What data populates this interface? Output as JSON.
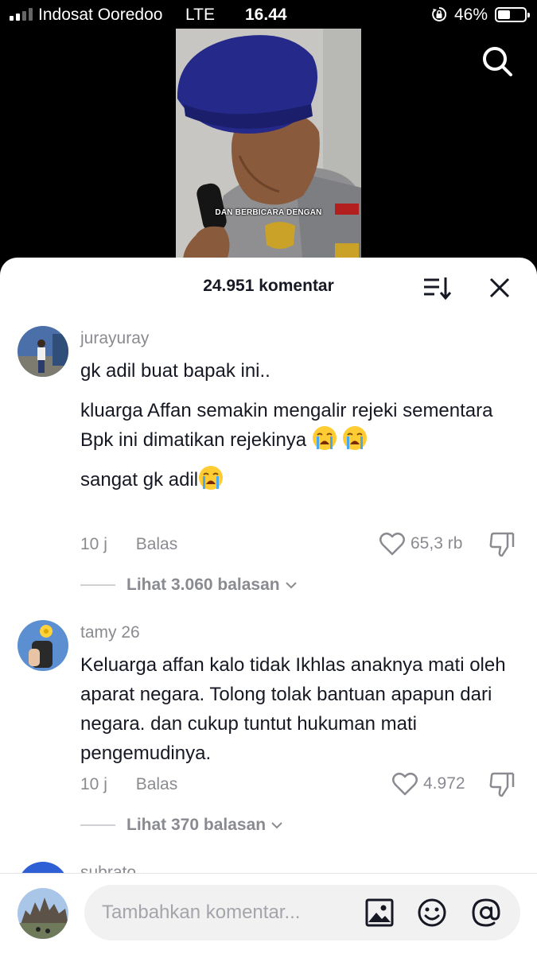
{
  "status_bar": {
    "carrier": "Indosat Ooredoo",
    "network": "LTE",
    "time": "16.44",
    "battery_percent": "46%",
    "battery_level": 0.46
  },
  "video": {
    "caption": "DAN BERBICARA DENGAN"
  },
  "comments_sheet": {
    "count_label": "24.951 komentar",
    "comments": [
      {
        "username": "jurayuray",
        "paragraphs": [
          "gk adil buat bapak ini..",
          "kluarga Affan semakin mengalir rejeki sementara Bpk ini dimatikan rejekinya",
          "sangat gk adil"
        ],
        "time": "10 j",
        "reply_label": "Balas",
        "likes": "65,3 rb",
        "view_replies": "Lihat 3.060 balasan"
      },
      {
        "username": "tamy 26",
        "paragraphs": [
          "Keluarga affan kalo tidak Ikhlas anaknya mati oleh aparat negara. Tolong tolak bantuan apapun dari negara. dan cukup tuntut hukuman mati pengemudinya."
        ],
        "time": "10 j",
        "reply_label": "Balas",
        "likes": "4.972",
        "view_replies": "Lihat 370 balasan"
      }
    ],
    "partial_username": "subrato"
  },
  "composer": {
    "placeholder": "Tambahkan komentar..."
  },
  "icons": {
    "search": "search-icon",
    "sort": "sort-icon",
    "close": "close-icon",
    "heart": "heart-icon",
    "dislike": "thumbs-down-icon",
    "image": "image-icon",
    "emoji": "emoji-icon",
    "mention": "at-mention-icon",
    "crying_emoji": "loudly-crying-face"
  }
}
